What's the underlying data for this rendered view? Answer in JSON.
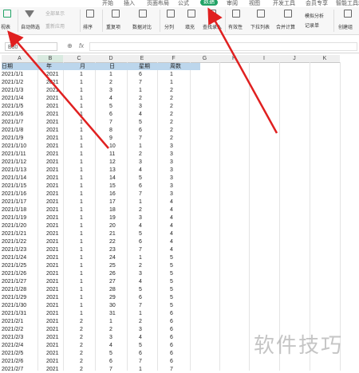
{
  "menu_tabs": [
    "开始",
    "插入",
    "页面布局",
    "公式",
    "数据",
    "审阅",
    "视图",
    "开发工具",
    "会员专享",
    "智能工具箱"
  ],
  "active_tab": "数据",
  "ribbon": {
    "pivot": "视表",
    "autofilter": "自动筛选",
    "show_all": "全部显示",
    "reapply": "重新应用",
    "sort": "排序",
    "duplicates": "重复项",
    "compare": "数据对比",
    "split": "分列",
    "fill": "填充",
    "find_entry": "查找录入",
    "validity": "有效性",
    "dropdown": "下拉列表",
    "merge_calc": "合并计算",
    "simulate": "模拟分析",
    "record": "记录单",
    "create_group": "创建组"
  },
  "formula_bar": {
    "name_box": "B30",
    "fx": "fx"
  },
  "columns": [
    "A",
    "B",
    "C",
    "D",
    "E",
    "F",
    "G",
    "H",
    "I",
    "J",
    "K"
  ],
  "table": {
    "headers": [
      "日期",
      "年",
      "月",
      "日",
      "星期",
      "周数"
    ],
    "rows": [
      [
        "2021/1/1",
        "2021",
        "1",
        "1",
        "6",
        "1"
      ],
      [
        "2021/1/2",
        "2021",
        "1",
        "2",
        "7",
        "1"
      ],
      [
        "2021/1/3",
        "2021",
        "1",
        "3",
        "1",
        "2"
      ],
      [
        "2021/1/4",
        "2021",
        "1",
        "4",
        "2",
        "2"
      ],
      [
        "2021/1/5",
        "2021",
        "1",
        "5",
        "3",
        "2"
      ],
      [
        "2021/1/6",
        "2021",
        "1",
        "6",
        "4",
        "2"
      ],
      [
        "2021/1/7",
        "2021",
        "1",
        "7",
        "5",
        "2"
      ],
      [
        "2021/1/8",
        "2021",
        "1",
        "8",
        "6",
        "2"
      ],
      [
        "2021/1/9",
        "2021",
        "1",
        "9",
        "7",
        "2"
      ],
      [
        "2021/1/10",
        "2021",
        "1",
        "10",
        "1",
        "3"
      ],
      [
        "2021/1/11",
        "2021",
        "1",
        "11",
        "2",
        "3"
      ],
      [
        "2021/1/12",
        "2021",
        "1",
        "12",
        "3",
        "3"
      ],
      [
        "2021/1/13",
        "2021",
        "1",
        "13",
        "4",
        "3"
      ],
      [
        "2021/1/14",
        "2021",
        "1",
        "14",
        "5",
        "3"
      ],
      [
        "2021/1/15",
        "2021",
        "1",
        "15",
        "6",
        "3"
      ],
      [
        "2021/1/16",
        "2021",
        "1",
        "16",
        "7",
        "3"
      ],
      [
        "2021/1/17",
        "2021",
        "1",
        "17",
        "1",
        "4"
      ],
      [
        "2021/1/18",
        "2021",
        "1",
        "18",
        "2",
        "4"
      ],
      [
        "2021/1/19",
        "2021",
        "1",
        "19",
        "3",
        "4"
      ],
      [
        "2021/1/20",
        "2021",
        "1",
        "20",
        "4",
        "4"
      ],
      [
        "2021/1/21",
        "2021",
        "1",
        "21",
        "5",
        "4"
      ],
      [
        "2021/1/22",
        "2021",
        "1",
        "22",
        "6",
        "4"
      ],
      [
        "2021/1/23",
        "2021",
        "1",
        "23",
        "7",
        "4"
      ],
      [
        "2021/1/24",
        "2021",
        "1",
        "24",
        "1",
        "5"
      ],
      [
        "2021/1/25",
        "2021",
        "1",
        "25",
        "2",
        "5"
      ],
      [
        "2021/1/26",
        "2021",
        "1",
        "26",
        "3",
        "5"
      ],
      [
        "2021/1/27",
        "2021",
        "1",
        "27",
        "4",
        "5"
      ],
      [
        "2021/1/28",
        "2021",
        "1",
        "28",
        "5",
        "5"
      ],
      [
        "2021/1/29",
        "2021",
        "1",
        "29",
        "6",
        "5"
      ],
      [
        "2021/1/30",
        "2021",
        "1",
        "30",
        "7",
        "5"
      ],
      [
        "2021/1/31",
        "2021",
        "1",
        "31",
        "1",
        "6"
      ],
      [
        "2021/2/1",
        "2021",
        "2",
        "1",
        "2",
        "6"
      ],
      [
        "2021/2/2",
        "2021",
        "2",
        "2",
        "3",
        "6"
      ],
      [
        "2021/2/3",
        "2021",
        "2",
        "3",
        "4",
        "6"
      ],
      [
        "2021/2/4",
        "2021",
        "2",
        "4",
        "5",
        "6"
      ],
      [
        "2021/2/5",
        "2021",
        "2",
        "5",
        "6",
        "6"
      ],
      [
        "2021/2/6",
        "2021",
        "2",
        "6",
        "7",
        "6"
      ],
      [
        "2021/2/7",
        "2021",
        "2",
        "7",
        "1",
        "7"
      ]
    ]
  },
  "watermark": "软件技巧",
  "colors": {
    "accent": "#21a366",
    "header_fill": "#bcd6ec",
    "arrow": "#e02020"
  }
}
